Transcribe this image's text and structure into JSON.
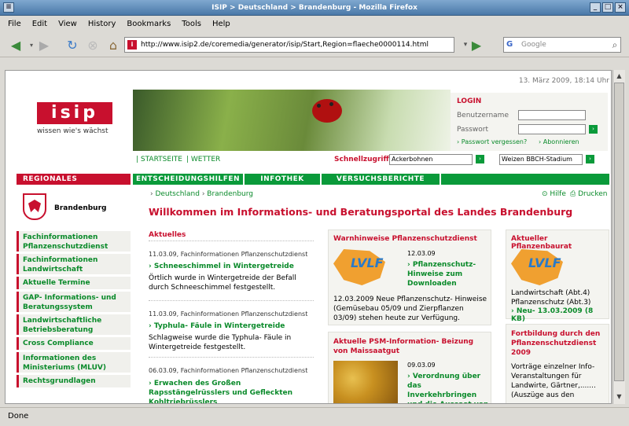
{
  "window": {
    "title": "ISIP > Deutschland > Brandenburg - Mozilla Firefox"
  },
  "menu": [
    "File",
    "Edit",
    "View",
    "History",
    "Bookmarks",
    "Tools",
    "Help"
  ],
  "nav": {
    "url": "http://www.isip2.de/coremedia/generator/isip/Start,Region=flaeche0000114.html",
    "search_placeholder": "Google"
  },
  "status": "Done",
  "page": {
    "datetime": "13. März 2009, 18:14 Uhr",
    "logo_text": "isip",
    "tagline": "wissen wie's wächst",
    "toplinks": [
      "STARTSEITE",
      "WETTER"
    ],
    "login": {
      "title": "LOGIN",
      "user_label": "Benutzername",
      "pass_label": "Passwort",
      "forgot": "Passwort vergessen?",
      "subscribe": "Abonnieren"
    },
    "quick": {
      "label": "Schnellzugriff",
      "option1": "Ackerbohnen",
      "option2": "Weizen BBCH-Stadium"
    },
    "region_header": "REGIONALES",
    "tabs": [
      "ENTSCHEIDUNGSHILFEN",
      "INFOTHEK",
      "VERSUCHSBERICHTE"
    ],
    "region_name": "Brandenburg",
    "sidenav": [
      "Fachinformationen Pflanzenschutzdienst",
      "Fachinformationen Landwirtschaft",
      "Aktuelle Termine",
      "GAP- Informations- und Beratungssystem",
      "Landwirtschaftliche Betriebsberatung",
      "Cross Compliance",
      "Informationen des Ministeriums (MLUV)",
      "Rechtsgrundlagen"
    ],
    "breadcrumb": {
      "a": "Deutschland",
      "b": "Brandenburg"
    },
    "help": "Hilfe",
    "print": "Drucken",
    "heading": "Willkommen im Informations- und Beratungsportal des Landes Brandenburg",
    "news": {
      "title": "Aktuelles",
      "items": [
        {
          "meta": "11.03.09, Fachinformationen Pflanzenschutzdienst",
          "link": "Schneeschimmel in Wintergetreide",
          "text": "Örtlich wurde in Wintergetreide der Befall durch Schneeschimmel festgestellt."
        },
        {
          "meta": "11.03.09, Fachinformationen Pflanzenschutzdienst",
          "link": "Typhula- Fäule in Wintergetreide",
          "text": "Schlagweise wurde die Typhula- Fäule in Wintergetreide festgestellt."
        },
        {
          "meta": "06.03.09, Fachinformationen Pflanzenschutzdienst",
          "link": "Erwachen des Großen Rapsstängelrüsslers und Gefleckten Kohltriebrüsslers",
          "text": ""
        }
      ]
    },
    "warn": {
      "title": "Warnhinweise Pflanzenschutzdienst",
      "logo": "LVLF",
      "date": "12.03.09",
      "link": "Pflanzenschutz-Hinweise zum Downloaden",
      "text": "12.03.2009 Neue Pflanzenschutz- Hinweise (Gemüsebau 05/09 und Zierpflanzen 03/09) stehen heute zur Verfügung."
    },
    "psm": {
      "title": "Aktuelle PSM-Information- Beizung von Maissaatgut",
      "date": "09.03.09",
      "link": "Verordnung über das Inverkehrbringen und die Aussaat von"
    },
    "rat": {
      "title": "Aktueller Pflanzenbaurat",
      "logo": "LVLF",
      "text1": "Landwirtschaft (Abt.4)",
      "text2": "Pflanzenschutz (Abt.3)",
      "link": "Neu- 13.03.2009 (8 KB)"
    },
    "fort": {
      "title": "Fortbildung durch den Pflanzenschutzdienst 2009",
      "text": "Vorträge einzelner Info-Veranstaltungen für Landwirte, Gärtner,....... (Auszüge aus den"
    }
  }
}
